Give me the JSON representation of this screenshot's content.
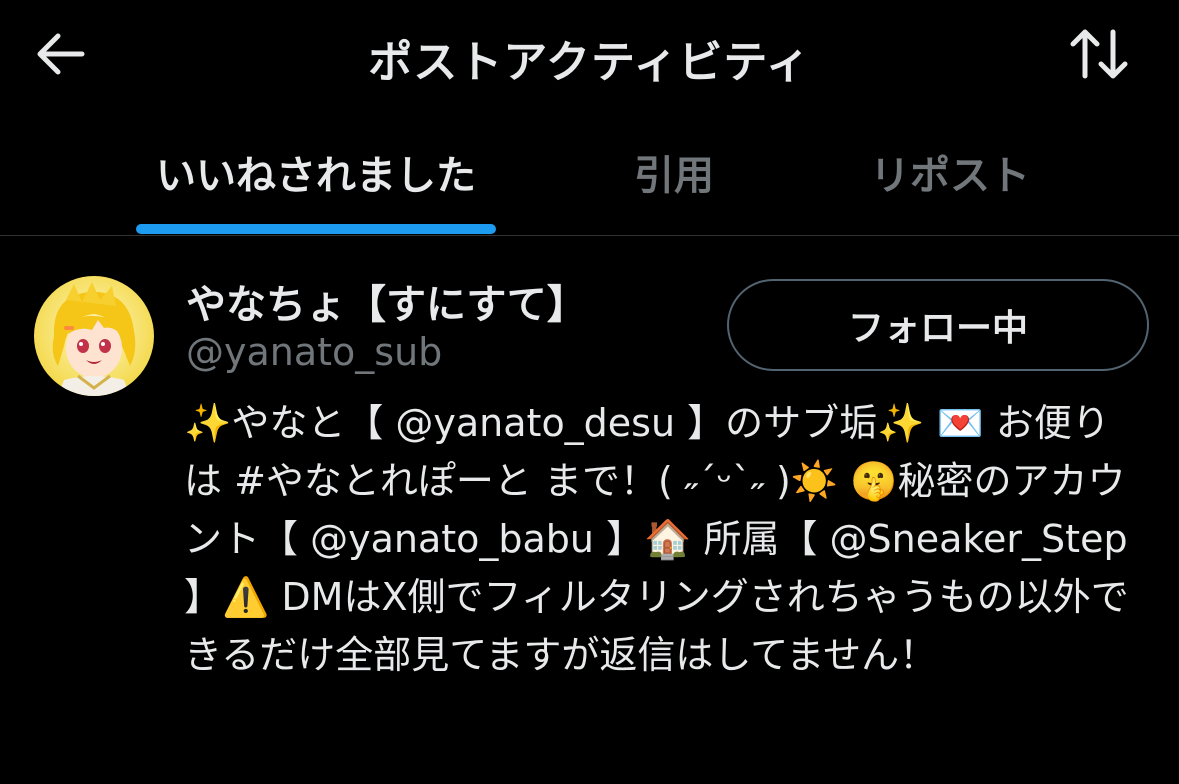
{
  "header": {
    "title": "ポストアクティビティ",
    "back_icon": "arrow-left-icon",
    "sort_icon": "sort-arrows-icon"
  },
  "tabs": [
    {
      "label": "いいねされました",
      "active": true
    },
    {
      "label": "引用",
      "active": false
    },
    {
      "label": "リポスト",
      "active": false
    }
  ],
  "colors": {
    "background": "#000000",
    "accent": "#1d9bf0",
    "text_primary": "#e7e9ea",
    "text_secondary": "#71767b",
    "border": "#2f3336"
  },
  "user": {
    "display_name": "やなちょ【すにすて】",
    "handle": "@yanato_sub",
    "follow_label": "フォロー中",
    "bio": "✨やなと【 @yanato_desu 】のサブ垢✨ 💌 お便りは #やなとれぽーと まで！( ˶ˊᵕˋ˶ )☀️ 🤫秘密のアカウント【 @yanato_babu 】🏠 所属【 @Sneaker_Step 】⚠️ DMはX側でフィルタリングされちゃうもの以外できるだけ全部見てますが返信はしてません！"
  }
}
